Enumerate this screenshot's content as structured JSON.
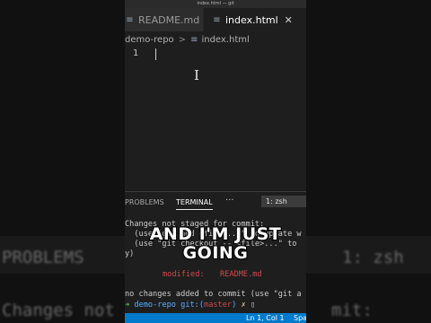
{
  "window": {
    "title": "index.html — git"
  },
  "tabs": [
    {
      "label": "README.md",
      "icon": "text-file-icon",
      "active": false
    },
    {
      "label": "index.html",
      "icon": "text-file-icon",
      "active": true,
      "close": "✕"
    }
  ],
  "breadcrumb": {
    "folder": "demo-repo",
    "separator": ">",
    "file": "index.html"
  },
  "editor": {
    "line_number": "1"
  },
  "panel": {
    "tabs": [
      "PROBLEMS",
      "TERMINAL"
    ],
    "more": "···",
    "shell": "1: zsh"
  },
  "terminal": {
    "line1": "Changes not staged for commit:",
    "line2": "  (use \"git add <file>...\" to update w",
    "line3": "  (use \"git checkout -- <file>...\" to",
    "line4": "y)",
    "modified_label": "modified:",
    "modified_file": "README.md",
    "line6": "no changes added to commit (use \"git a",
    "prompt_arrow": "➜",
    "prompt_dir": "demo-repo",
    "prompt_git": "git:(",
    "prompt_branch": "master",
    "prompt_close": ")",
    "prompt_mark": "✗",
    "cursor": "▯"
  },
  "caption": {
    "line1": "AND I'M JUST",
    "line2": "GOING"
  },
  "statusbar": {
    "position": "Ln 1, Col 1",
    "spaces": "Spa"
  },
  "background": {
    "left_word_1": "PROBLEMS",
    "left_word_2": "Changes not",
    "right_word_1": "1: zsh",
    "right_word_2": "mit:"
  },
  "colors": {
    "accent": "#007acc",
    "prompt_arrow": "#56c96b",
    "modified": "#d04a4a"
  }
}
